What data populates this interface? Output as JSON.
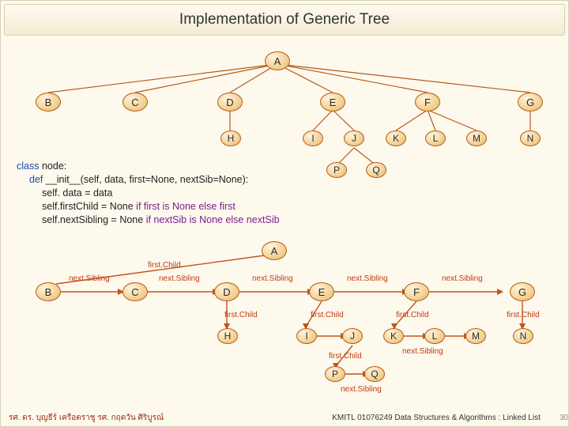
{
  "title": "Implementation of Generic Tree",
  "tree1": {
    "A": "A",
    "B": "B",
    "C": "C",
    "D": "D",
    "E": "E",
    "F": "F",
    "G": "G",
    "H": "H",
    "I": "I",
    "J": "J",
    "K": "K",
    "L": "L",
    "M": "M",
    "N": "N",
    "P": "P",
    "Q": "Q"
  },
  "code": {
    "l1a": "class",
    "l1b": "node:",
    "l2a": "def",
    "l2b": "__init__(self,  data, first=None, nextSib=None):",
    "l3": "self. data = data",
    "l4a": "self.firstChild = None",
    "l4b": "if first is None else first",
    "l5a": "self.nextSibling = None",
    "l5b": "if nextSib is None else nextSib"
  },
  "labels": {
    "firstChild": "first.Child",
    "nextSibling": "next.Sibling"
  },
  "footer": {
    "left": "รศ. ดร. บุญธีร์       เครือตราชู       รศ. กฤตวัน   ศิริบูรณ์",
    "right": "KMITL   01076249 Data Structures & Algorithms : Linked List",
    "page": "30"
  }
}
